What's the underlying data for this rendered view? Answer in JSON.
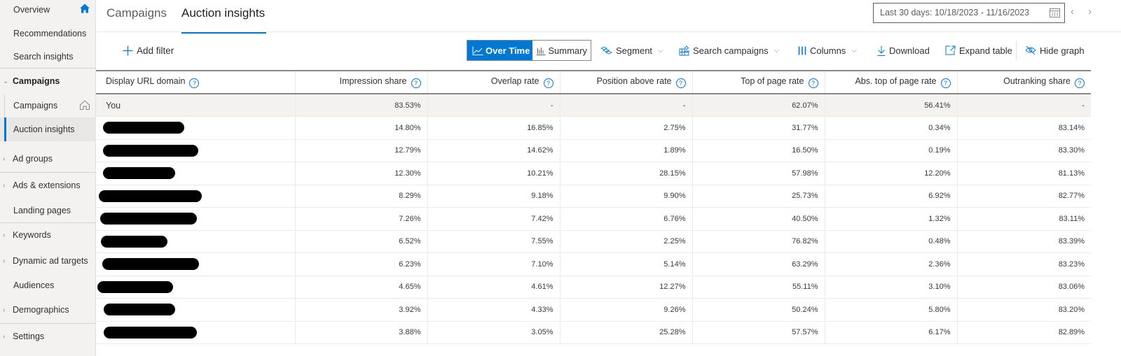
{
  "sidebar": {
    "items": [
      {
        "label": "Overview",
        "type": "item",
        "icon": "home-filled-icon"
      },
      {
        "label": "Recommendations",
        "type": "item"
      },
      {
        "label": "Search insights",
        "type": "item"
      },
      {
        "label": "Campaigns",
        "type": "group",
        "expanded": true
      },
      {
        "label": "Campaigns",
        "type": "subitem",
        "icon": "home-outline-icon"
      },
      {
        "label": "Auction insights",
        "type": "subitem",
        "active": true
      },
      {
        "label": "Ad groups",
        "type": "group",
        "expanded": false
      },
      {
        "label": "Ads & extensions",
        "type": "group",
        "expanded": false
      },
      {
        "label": "Landing pages",
        "type": "item"
      },
      {
        "label": "Keywords",
        "type": "group",
        "expanded": false
      },
      {
        "label": "Dynamic ad targets",
        "type": "group",
        "expanded": false
      },
      {
        "label": "Audiences",
        "type": "item"
      },
      {
        "label": "Demographics",
        "type": "group",
        "expanded": false
      },
      {
        "label": "Settings",
        "type": "group",
        "expanded": false
      }
    ]
  },
  "tabs": [
    {
      "label": "Campaigns",
      "active": false
    },
    {
      "label": "Auction insights",
      "active": true
    }
  ],
  "date_range": {
    "label": "Last 30 days: 10/18/2023 - 11/16/2023",
    "prev": "‹",
    "next": "›"
  },
  "toolbar": {
    "add_filter": "Add filter",
    "view_over_time": "Over Time",
    "view_summary": "Summary",
    "segment": "Segment",
    "search_campaigns": "Search campaigns",
    "columns": "Columns",
    "download": "Download",
    "expand_table": "Expand table",
    "hide_graph": "Hide graph"
  },
  "colors": {
    "accent": "#0078d4",
    "sidebar_bg": "#f3f2f1",
    "you_row_bg": "#f3f2f1"
  },
  "table": {
    "help_glyph": "?",
    "columns": [
      "Display URL domain",
      "Impression share",
      "Overlap rate",
      "Position above rate",
      "Top of page rate",
      "Abs. top of page rate",
      "Outranking share"
    ],
    "rows": [
      {
        "domain": "You",
        "redacted": false,
        "values": [
          "83.53%",
          "-",
          "-",
          "62.07%",
          "56.41%",
          "-"
        ]
      },
      {
        "domain": "",
        "redacted": true,
        "values": [
          "14.80%",
          "16.85%",
          "2.75%",
          "31.77%",
          "0.34%",
          "83.14%"
        ]
      },
      {
        "domain": "",
        "redacted": true,
        "values": [
          "12.79%",
          "14.62%",
          "1.89%",
          "16.50%",
          "0.19%",
          "83.30%"
        ]
      },
      {
        "domain": "",
        "redacted": true,
        "values": [
          "12.30%",
          "10.21%",
          "28.15%",
          "57.98%",
          "12.20%",
          "81.13%"
        ]
      },
      {
        "domain": "",
        "redacted": true,
        "values": [
          "8.29%",
          "9.18%",
          "9.90%",
          "25.73%",
          "6.92%",
          "82.77%"
        ]
      },
      {
        "domain": "",
        "redacted": true,
        "values": [
          "7.26%",
          "7.42%",
          "6.76%",
          "40.50%",
          "1.32%",
          "83.11%"
        ]
      },
      {
        "domain": "",
        "redacted": true,
        "values": [
          "6.52%",
          "7.55%",
          "2.25%",
          "76.82%",
          "0.48%",
          "83.39%"
        ]
      },
      {
        "domain": "",
        "redacted": true,
        "values": [
          "6.23%",
          "7.10%",
          "5.14%",
          "63.29%",
          "2.36%",
          "83.23%"
        ]
      },
      {
        "domain": "",
        "redacted": true,
        "values": [
          "4.65%",
          "4.61%",
          "12.27%",
          "55.11%",
          "3.10%",
          "83.06%"
        ]
      },
      {
        "domain": "",
        "redacted": true,
        "values": [
          "3.92%",
          "4.33%",
          "9.26%",
          "50.24%",
          "5.80%",
          "83.20%"
        ]
      },
      {
        "domain": "",
        "redacted": true,
        "values": [
          "3.88%",
          "3.05%",
          "25.28%",
          "57.57%",
          "6.17%",
          "82.89%"
        ]
      }
    ]
  }
}
